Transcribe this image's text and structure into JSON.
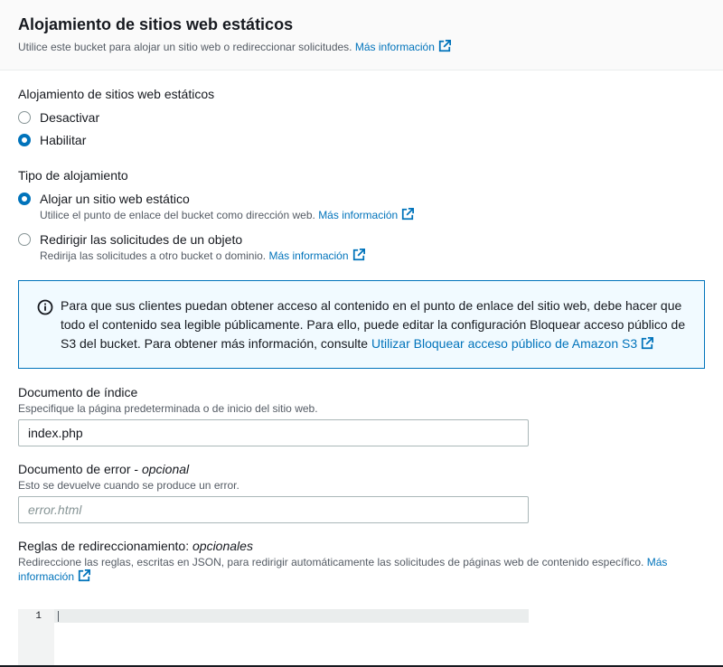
{
  "header": {
    "title": "Alojamiento de sitios web estáticos",
    "description": "Utilice este bucket para alojar un sitio web o redireccionar solicitudes.",
    "learn_more": "Más información"
  },
  "hosting": {
    "label": "Alojamiento de sitios web estáticos",
    "options": [
      {
        "label": "Desactivar",
        "selected": false
      },
      {
        "label": "Habilitar",
        "selected": true
      }
    ]
  },
  "hosting_type": {
    "label": "Tipo de alojamiento",
    "options": [
      {
        "label": "Alojar un sitio web estático",
        "description": "Utilice el punto de enlace del bucket como dirección web.",
        "link": "Más información",
        "selected": true
      },
      {
        "label": "Redirigir las solicitudes de un objeto",
        "description": "Redirija las solicitudes a otro bucket o dominio.",
        "link": "Más información",
        "selected": false
      }
    ]
  },
  "info_alert": {
    "text": "Para que sus clientes puedan obtener acceso al contenido en el punto de enlace del sitio web, debe hacer que todo el contenido sea legible públicamente. Para ello, puede editar la configuración Bloquear acceso público de S3 del bucket. Para obtener más información, consulte",
    "link": "Utilizar Bloquear acceso público de Amazon S3"
  },
  "index_document": {
    "label": "Documento de índice",
    "description": "Especifique la página predeterminada o de inicio del sitio web.",
    "value": "index.php"
  },
  "error_document": {
    "label": "Documento de error",
    "optional": "opcional",
    "description": "Esto se devuelve cuando se produce un error.",
    "placeholder": "error.html"
  },
  "redirect_rules": {
    "label": "Reglas de redireccionamiento:",
    "optional": "opcionales",
    "description": "Redireccione las reglas, escritas en JSON, para redirigir automáticamente las solicitudes de páginas web de contenido específico.",
    "link_part1": "Más",
    "link_part2": "información",
    "line_number": "1"
  },
  "colors": {
    "link": "#0073bb",
    "radio_selected": "#0073bb",
    "info_bg": "#f1faff",
    "info_border": "#0073bb"
  }
}
